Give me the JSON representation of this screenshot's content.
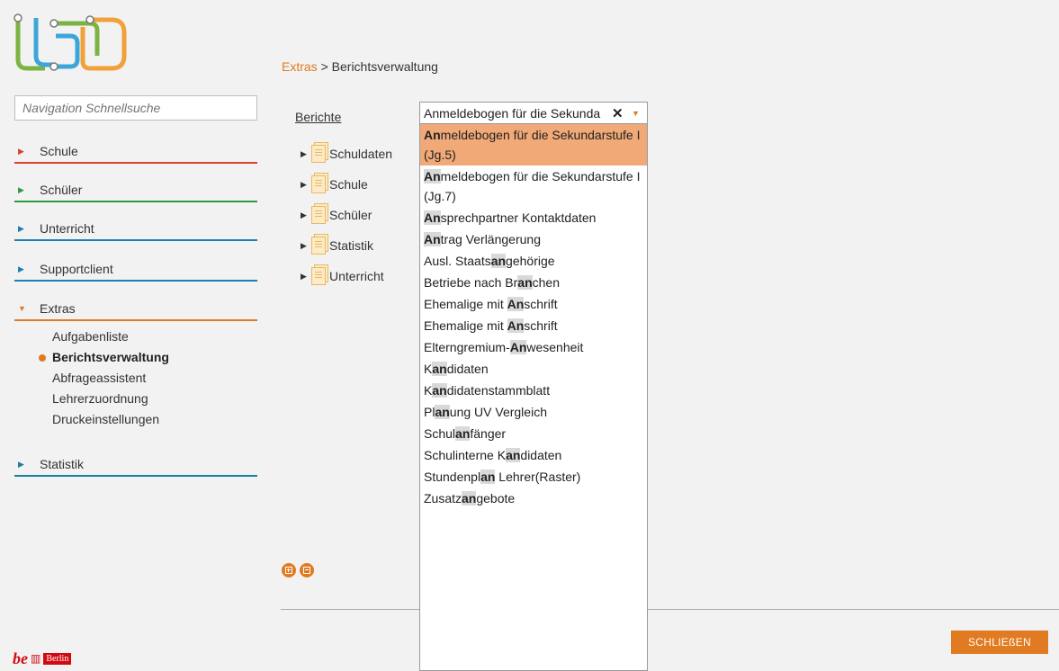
{
  "search": {
    "placeholder": "Navigation Schnellsuche"
  },
  "nav": {
    "sections": [
      {
        "label": "Schule",
        "color": "#d5452c"
      },
      {
        "label": "Schüler",
        "color": "#2e9b3f"
      },
      {
        "label": "Unterricht",
        "color": "#1f7db8"
      },
      {
        "label": "Supportclient",
        "color": "#1f7db8"
      },
      {
        "label": "Extras",
        "color": "#e07b22"
      },
      {
        "label": "Statistik",
        "color": "#17829a"
      }
    ],
    "extras_items": [
      "Aufgabenliste",
      "Berichtsverwaltung",
      "Abfrageassistent",
      "Lehrerzuordnung",
      "Druckeinstellungen"
    ],
    "active_item": "Berichtsverwaltung"
  },
  "breadcrumb": {
    "link": "Extras",
    "separator": " > ",
    "current": "Berichtsverwaltung"
  },
  "berichte_label": "Berichte",
  "tree": [
    "Schuldaten",
    "Schule",
    "Schüler",
    "Statistik",
    "Unterricht"
  ],
  "select": {
    "value": "Anmeldebogen für die Sekunda",
    "clear_icon": "close-icon"
  },
  "dropdown_options": [
    "Anmeldebogen für die Sekundarstufe I (Jg.5)",
    "Anmeldebogen für die Sekundarstufe I (Jg.7)",
    "Ansprechpartner Kontaktdaten",
    "Antrag Verlängerung",
    "Ausl. Staatsangehörige",
    "Betriebe nach Branchen",
    "Ehemalige mit Anschrift",
    "Ehemalige mit Anschrift",
    "Elterngremium-Anwesenheit",
    "Kandidaten",
    "Kandidatenstammblatt",
    "Planung UV Vergleich",
    "Schulanfänger",
    "Schulinterne Kandidaten",
    "Stundenplan Lehrer(Raster)",
    "Zusatzangebote"
  ],
  "search_term": "an",
  "close_button": "SCHLIEßEN",
  "footer": {
    "be": "be",
    "berlin": "Berlin"
  },
  "colors": {
    "accent": "#e07b22",
    "selected_option": "#f0a977",
    "berlin_red": "#d10a11"
  }
}
